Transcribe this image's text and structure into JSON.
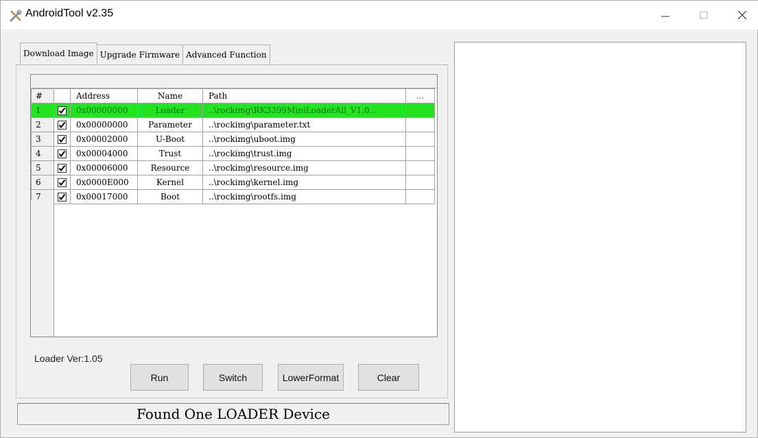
{
  "window": {
    "title": "AndroidTool v2.35"
  },
  "tabs": [
    {
      "label": "Download Image",
      "active": true
    },
    {
      "label": "Upgrade Firmware",
      "active": false
    },
    {
      "label": "Advanced Function",
      "active": false
    }
  ],
  "grid": {
    "headers": {
      "num": "#",
      "address": "Address",
      "name": "Name",
      "path": "Path",
      "extra": "..."
    },
    "rows": [
      {
        "num": "1",
        "checked": true,
        "address": "0x00000000",
        "name": "Loader",
        "path": "..\\rockimg\\RK3399MiniLoaderAll_V1.0...",
        "highlight": true
      },
      {
        "num": "2",
        "checked": true,
        "address": "0x00000000",
        "name": "Parameter",
        "path": "..\\rockimg\\parameter.txt",
        "highlight": false
      },
      {
        "num": "3",
        "checked": true,
        "address": "0x00002000",
        "name": "U-Boot",
        "path": "..\\rockimg\\uboot.img",
        "highlight": false
      },
      {
        "num": "4",
        "checked": true,
        "address": "0x00004000",
        "name": "Trust",
        "path": "..\\rockimg\\trust.img",
        "highlight": false
      },
      {
        "num": "5",
        "checked": true,
        "address": "0x00006000",
        "name": "Resource",
        "path": "..\\rockimg\\resource.img",
        "highlight": false
      },
      {
        "num": "6",
        "checked": true,
        "address": "0x0000E000",
        "name": "Kernel",
        "path": "..\\rockimg\\kernel.img",
        "highlight": false
      },
      {
        "num": "7",
        "checked": true,
        "address": "0x00017000",
        "name": "Boot",
        "path": "..\\rockimg\\rootfs.img",
        "highlight": false
      }
    ]
  },
  "loader_version": "Loader Ver:1.05",
  "buttons": {
    "run": "Run",
    "switch": "Switch",
    "lowerformat": "LowerFormat",
    "clear": "Clear"
  },
  "status": "Found One LOADER Device",
  "colors": {
    "highlight_row": "#22e422"
  },
  "icons": {
    "app": "android-tool-icon",
    "minimize": "minimize-icon",
    "maximize": "maximize-icon",
    "close": "close-icon"
  }
}
